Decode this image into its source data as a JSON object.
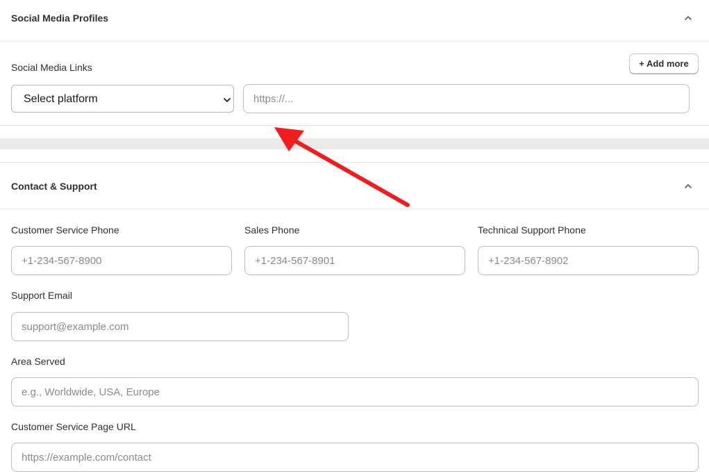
{
  "social": {
    "title": "Social Media Profiles",
    "links_label": "Social Media Links",
    "add_more": "+ Add more",
    "platform_select": "Select platform",
    "url_placeholder": "https://..."
  },
  "contact": {
    "title": "Contact & Support",
    "customer_phone": {
      "label": "Customer Service Phone",
      "placeholder": "+1-234-567-8900"
    },
    "sales_phone": {
      "label": "Sales Phone",
      "placeholder": "+1-234-567-8901"
    },
    "tech_phone": {
      "label": "Technical Support Phone",
      "placeholder": "+1-234-567-8902"
    },
    "support_email": {
      "label": "Support Email",
      "placeholder": "support@example.com"
    },
    "area_served": {
      "label": "Area Served",
      "placeholder": "e.g., Worldwide, USA, Europe"
    },
    "service_url": {
      "label": "Customer Service Page URL",
      "placeholder": "https://example.com/contact"
    }
  },
  "icons": {
    "collapse": "chevron-up-icon",
    "select_caret": "chevron-down-icon",
    "annotation": "red-arrow-icon"
  },
  "colors": {
    "annotation_arrow": "#f01e1e",
    "field_border": "#bdbdbd",
    "placeholder": "#8a8a8a",
    "section_gap": "#ebebeb"
  }
}
